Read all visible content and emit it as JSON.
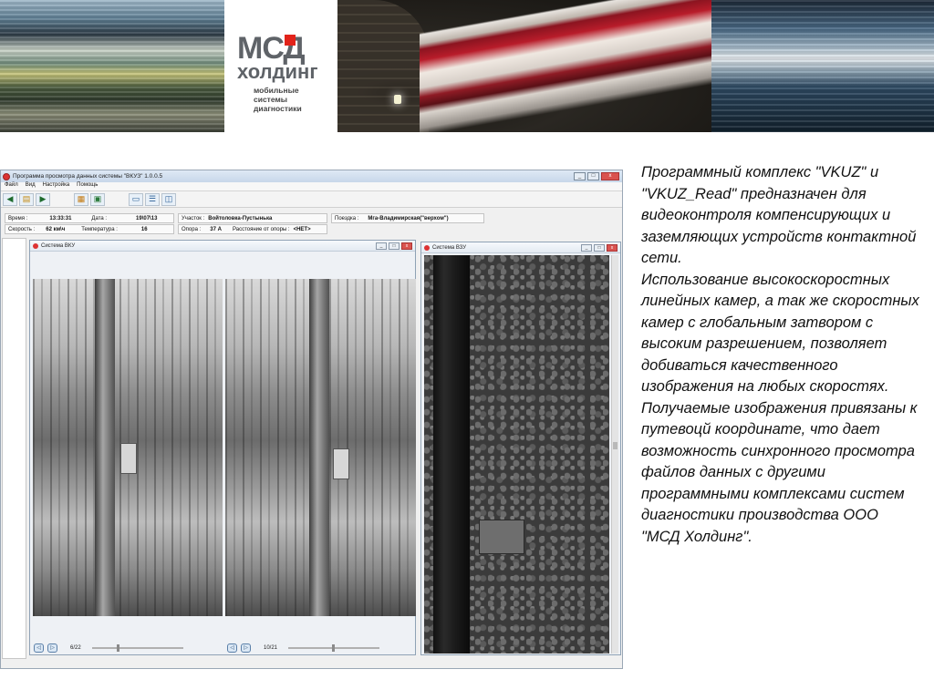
{
  "logo": {
    "brand": "МСД",
    "name": "холдинг",
    "tagline": "мобильные системы диагностики"
  },
  "app": {
    "title": "Программа просмотра данных системы \"ВКУЗ\" 1.0.0.5",
    "window_buttons": [
      "_",
      "□",
      "x"
    ],
    "menu": [
      "Файл",
      "Вид",
      "Настройка",
      "Помощь"
    ],
    "toolbar_icons": [
      "back-icon",
      "folder-open-icon",
      "forward-icon",
      "grid-view-icon",
      "image-view-icon",
      "window-layout-icon",
      "split-horizontal-icon",
      "split-vertical-icon"
    ],
    "info": {
      "time_label": "Время :",
      "time_value": "13:33:31",
      "date_label": "Дата :",
      "date_value": "19\\07\\13",
      "speed_label": "Скорость :",
      "speed_value": "62 км\\ч",
      "temp_label": "Температура :",
      "temp_value": "16",
      "section_label": "Участок :",
      "section_value": "Войтоловка-Пустынька",
      "support_label": "Опора :",
      "support_value": "37 А",
      "distance_label": "Расстояние от опоры :",
      "distance_value": "<НЕТ>",
      "trip_label": "Поездка :",
      "trip_value": "Мга-Владимирская(\"верхом\")"
    },
    "panel_vku": {
      "title": "Система ВКУ",
      "left_counter": "6/22",
      "right_counter": "10/21",
      "left_progress": 0.27,
      "right_progress": 0.48
    },
    "panel_vzu": {
      "title": "Система ВЗУ",
      "scroll_position": 0.47
    }
  },
  "description": "Программный комплекс \"VKUZ\" и \"VKUZ_Read\" предназначен для видеоконтроля компенсирующих и заземляющих устройств контактной сети.\n Использование высокоскоростных линейных камер, а так же скоростных камер с глобальным затвором с высоким разрешением, позволяет добиваться качественного изображения на любых скоростях. Получаемые изображения привязаны к путевоцй координате, что дает возможность синхронного просмотра файлов данных с другими программными комплексами систем диагностики производства ООО \"МСД Холдинг\"."
}
